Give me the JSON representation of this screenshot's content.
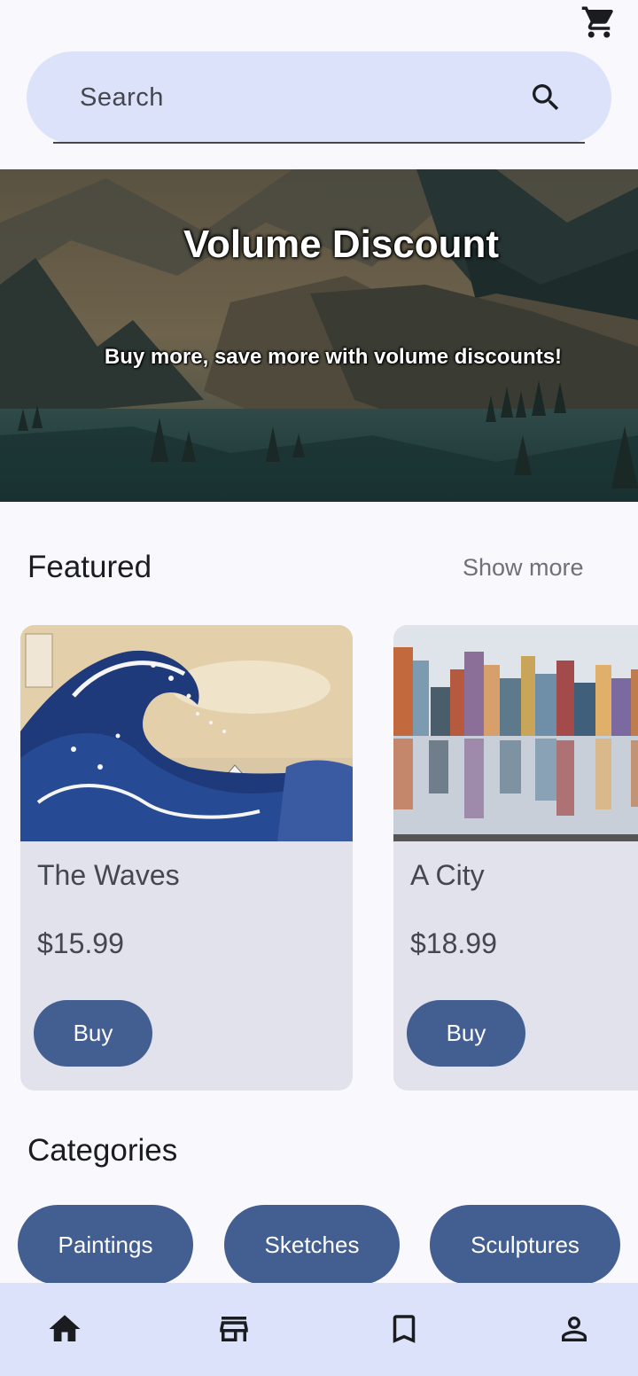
{
  "header": {
    "cart_icon": "shopping-cart-icon"
  },
  "search": {
    "placeholder": "Search",
    "icon": "search-icon"
  },
  "banner": {
    "title": "Volume Discount",
    "subtitle": "Buy more, save more with volume discounts!"
  },
  "featured": {
    "title": "Featured",
    "show_more_label": "Show more",
    "items": [
      {
        "title": "The Waves",
        "price": "$15.99",
        "buy_label": "Buy"
      },
      {
        "title": "A City",
        "price": "$18.99",
        "buy_label": "Buy"
      }
    ]
  },
  "categories": {
    "title": "Categories",
    "items": [
      {
        "label": "Paintings"
      },
      {
        "label": "Sketches"
      },
      {
        "label": "Sculptures"
      }
    ]
  },
  "bottom_nav": {
    "items": [
      {
        "icon": "home-icon"
      },
      {
        "icon": "store-icon"
      },
      {
        "icon": "bookmark-icon"
      },
      {
        "icon": "person-icon"
      }
    ]
  },
  "colors": {
    "background": "#f8f8fd",
    "search_bg": "#dbe2f9",
    "button": "#435e91",
    "card_bg": "#e1e2ec",
    "nav_bg": "#dbe2f9"
  }
}
